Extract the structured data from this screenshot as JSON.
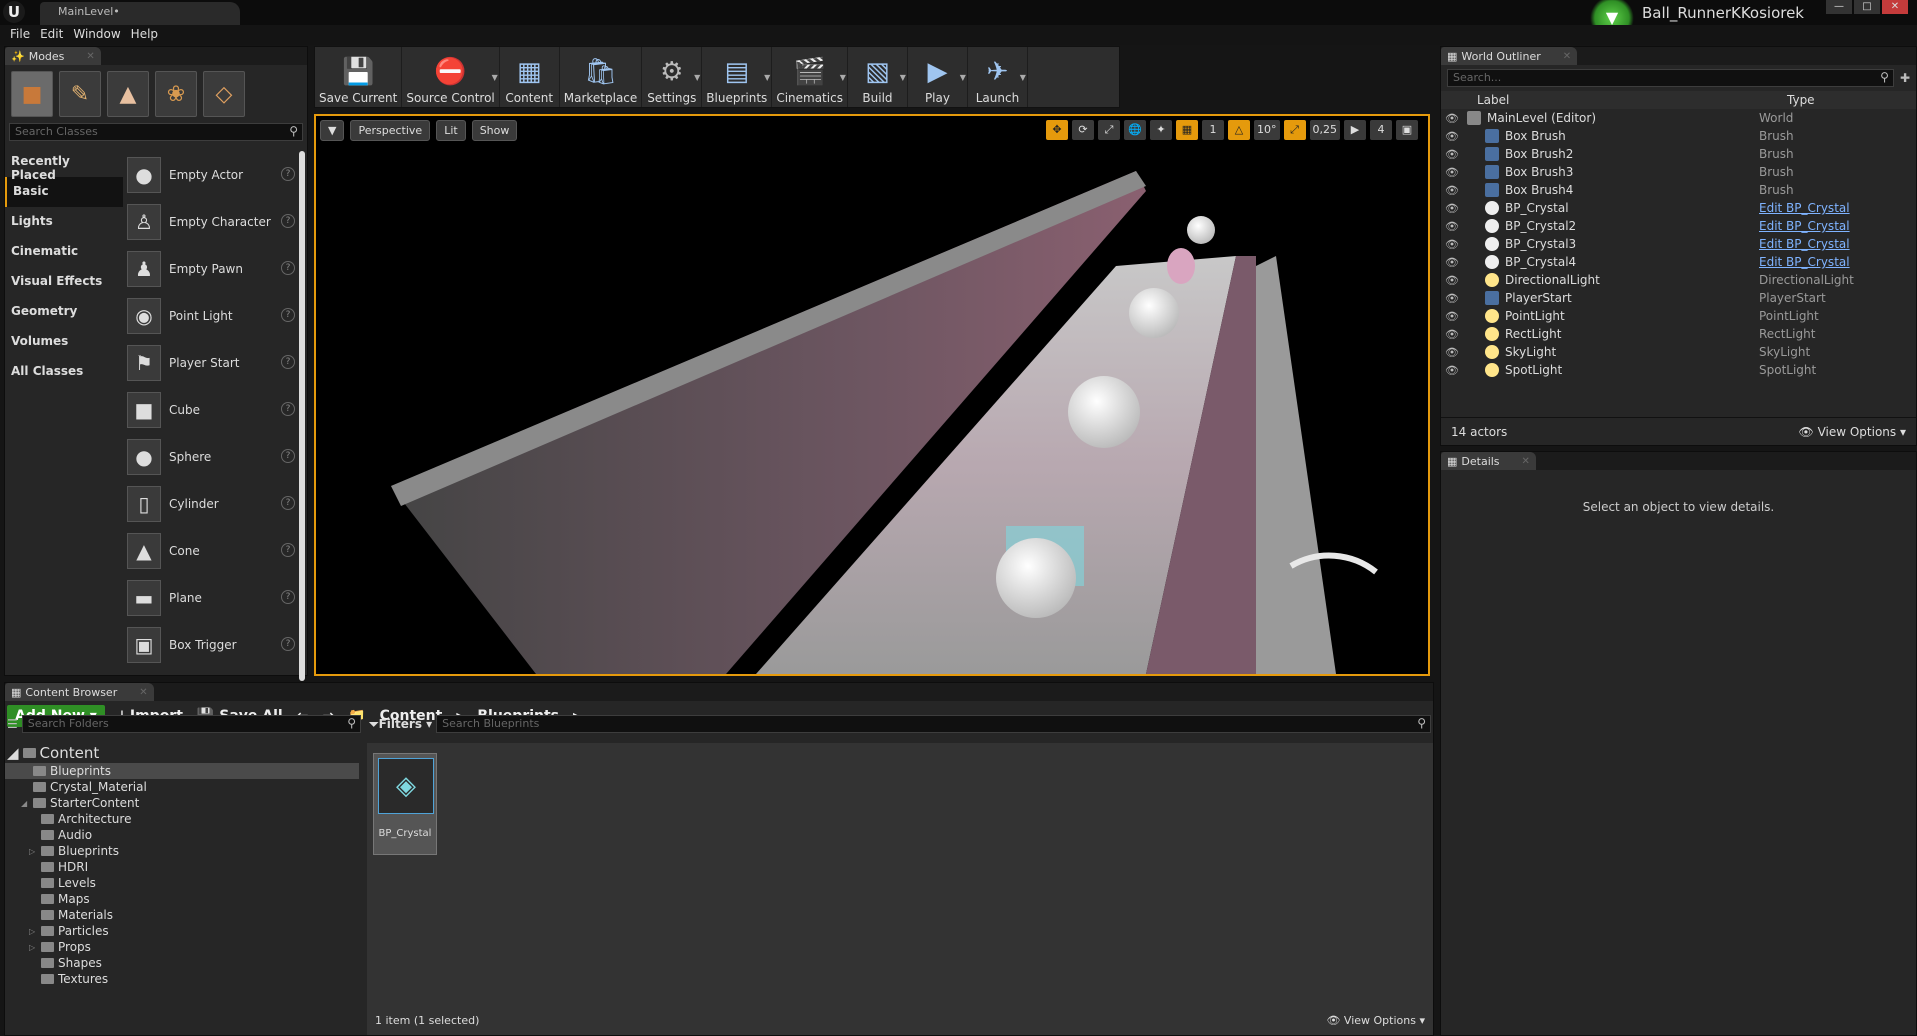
{
  "titlebar": {
    "doc_tab": "MainLevel•",
    "project_name": "Ball_RunnerKKosiorek",
    "min": "—",
    "max": "□",
    "close": "✕"
  },
  "menu": [
    "File",
    "Edit",
    "Window",
    "Help"
  ],
  "modes": {
    "tab_label": "Modes",
    "search_placeholder": "Search Classes",
    "categories": [
      "Recently Placed",
      "Basic",
      "Lights",
      "Cinematic",
      "Visual Effects",
      "Geometry",
      "Volumes",
      "All Classes"
    ],
    "active_category": "Basic",
    "items": [
      "Empty Actor",
      "Empty Character",
      "Empty Pawn",
      "Point Light",
      "Player Start",
      "Cube",
      "Sphere",
      "Cylinder",
      "Cone",
      "Plane",
      "Box Trigger"
    ]
  },
  "toolbar": {
    "buttons": [
      {
        "label": "Save Current",
        "icon": "save-icon",
        "glyph": "💾",
        "dropdown": false
      },
      {
        "label": "Source Control",
        "icon": "source-control-icon",
        "glyph": "⛔",
        "dropdown": true
      },
      {
        "label": "Content",
        "icon": "content-icon",
        "glyph": "▦",
        "dropdown": false
      },
      {
        "label": "Marketplace",
        "icon": "marketplace-icon",
        "glyph": "🛍",
        "dropdown": false
      },
      {
        "label": "Settings",
        "icon": "settings-icon",
        "glyph": "⚙",
        "dropdown": true
      },
      {
        "label": "Blueprints",
        "icon": "blueprints-icon",
        "glyph": "▤",
        "dropdown": true
      },
      {
        "label": "Cinematics",
        "icon": "cinematics-icon",
        "glyph": "🎬",
        "dropdown": true
      },
      {
        "label": "Build",
        "icon": "build-icon",
        "glyph": "▧",
        "dropdown": true
      },
      {
        "label": "Play",
        "icon": "play-icon",
        "glyph": "▶",
        "dropdown": true
      },
      {
        "label": "Launch",
        "icon": "launch-icon",
        "glyph": "✈",
        "dropdown": true
      }
    ]
  },
  "viewport": {
    "view_mode": "Perspective",
    "lit": "Lit",
    "show": "Show",
    "grid_snap": "1",
    "rot_snap": "10°",
    "scale_snap": "0,25",
    "cam_speed": "4"
  },
  "outliner": {
    "tab_label": "World Outliner",
    "search_placeholder": "Search...",
    "col_label": "Label",
    "col_type": "Type",
    "rows": [
      {
        "label": "MainLevel (Editor)",
        "type": "World",
        "link": false,
        "icon": "world"
      },
      {
        "label": "Box Brush",
        "type": "Brush",
        "link": false,
        "icon": "brush"
      },
      {
        "label": "Box Brush2",
        "type": "Brush",
        "link": false,
        "icon": "brush"
      },
      {
        "label": "Box Brush3",
        "type": "Brush",
        "link": false,
        "icon": "brush"
      },
      {
        "label": "Box Brush4",
        "type": "Brush",
        "link": false,
        "icon": "brush"
      },
      {
        "label": "BP_Crystal",
        "type": "Edit BP_Crystal",
        "link": true,
        "icon": "sphere"
      },
      {
        "label": "BP_Crystal2",
        "type": "Edit BP_Crystal",
        "link": true,
        "icon": "sphere"
      },
      {
        "label": "BP_Crystal3",
        "type": "Edit BP_Crystal",
        "link": true,
        "icon": "sphere"
      },
      {
        "label": "BP_Crystal4",
        "type": "Edit BP_Crystal",
        "link": true,
        "icon": "sphere"
      },
      {
        "label": "DirectionalLight",
        "type": "DirectionalLight",
        "link": false,
        "icon": "light"
      },
      {
        "label": "PlayerStart",
        "type": "PlayerStart",
        "link": false,
        "icon": "brush"
      },
      {
        "label": "PointLight",
        "type": "PointLight",
        "link": false,
        "icon": "light"
      },
      {
        "label": "RectLight",
        "type": "RectLight",
        "link": false,
        "icon": "light"
      },
      {
        "label": "SkyLight",
        "type": "SkyLight",
        "link": false,
        "icon": "light"
      },
      {
        "label": "SpotLight",
        "type": "SpotLight",
        "link": false,
        "icon": "light"
      }
    ],
    "actor_count": "14 actors",
    "view_options": "View Options"
  },
  "details": {
    "tab_label": "Details",
    "empty_msg": "Select an object to view details."
  },
  "content_browser": {
    "tab_label": "Content Browser",
    "add_new": "Add New",
    "import": "Import",
    "save_all": "Save All",
    "breadcrumb": [
      "Content",
      "Blueprints"
    ],
    "folder_search_placeholder": "Search Folders",
    "filters": "Filters",
    "asset_search_placeholder": "Search Blueprints",
    "root": "Content",
    "folders": [
      {
        "name": "Blueprints",
        "depth": 1,
        "selected": true,
        "expander": ""
      },
      {
        "name": "Crystal_Material",
        "depth": 1,
        "selected": false,
        "expander": ""
      },
      {
        "name": "StarterContent",
        "depth": 1,
        "selected": false,
        "expander": "◢"
      },
      {
        "name": "Architecture",
        "depth": 2,
        "selected": false,
        "expander": ""
      },
      {
        "name": "Audio",
        "depth": 2,
        "selected": false,
        "expander": ""
      },
      {
        "name": "Blueprints",
        "depth": 2,
        "selected": false,
        "expander": "▷"
      },
      {
        "name": "HDRI",
        "depth": 2,
        "selected": false,
        "expander": ""
      },
      {
        "name": "Levels",
        "depth": 2,
        "selected": false,
        "expander": ""
      },
      {
        "name": "Maps",
        "depth": 2,
        "selected": false,
        "expander": ""
      },
      {
        "name": "Materials",
        "depth": 2,
        "selected": false,
        "expander": ""
      },
      {
        "name": "Particles",
        "depth": 2,
        "selected": false,
        "expander": "▷"
      },
      {
        "name": "Props",
        "depth": 2,
        "selected": false,
        "expander": "▷"
      },
      {
        "name": "Shapes",
        "depth": 2,
        "selected": false,
        "expander": ""
      },
      {
        "name": "Textures",
        "depth": 2,
        "selected": false,
        "expander": ""
      }
    ],
    "asset_name": "BP_Crystal",
    "item_count": "1 item (1 selected)",
    "view_options": "View Options"
  }
}
